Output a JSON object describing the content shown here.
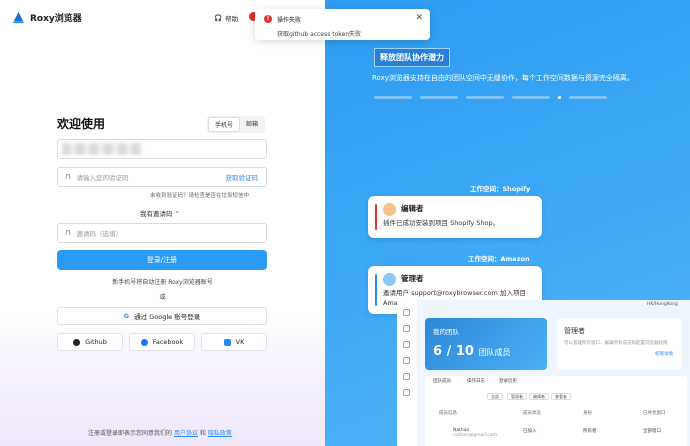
{
  "brand": {
    "name": "Roxy浏览器"
  },
  "header": {
    "help_label": "帮助"
  },
  "toast": {
    "title": "操作失败",
    "message": "获取github access token失败",
    "error_icon": "!"
  },
  "login": {
    "title": "欢迎使用",
    "tabs": [
      {
        "label": "手机号",
        "active": true
      },
      {
        "label": "邮箱",
        "active": false
      }
    ],
    "code_placeholder": "请输入您的验证码",
    "get_code_label": "获取验证码",
    "hint": "未收到验证码？请检查是否在垃圾短信中",
    "invite_toggle": "我有邀请码 ⌃",
    "invite_placeholder": "邀请码（选填）",
    "submit_label": "登录/注册",
    "auto_register_note": "新手机号将自动注册 Roxy浏览器账号",
    "or_label": "或",
    "google_label": "通过 Google 账号登录",
    "github_label": "Github",
    "facebook_label": "Facebook",
    "vk_label": "VK",
    "footer_prefix": "注册或登录即表示您同意我们的",
    "footer_terms": "用户协议",
    "footer_and": "和",
    "footer_privacy": "隐私政策"
  },
  "promo": {
    "headline": "释放团队协作潜力",
    "subline": "Roxy浏览器支持在自由的团队空间中无缝协作，每个工作空间数据与资源完全隔离。",
    "workspace1": "工作空间：Shopify",
    "card1": {
      "name": "编辑者",
      "text": "插件已成功安装到项目 Shopify Shop。",
      "accent": "#e0322e"
    },
    "workspace2": "工作空间：Amazon",
    "card2": {
      "name": "管理者",
      "text": "邀请用户 support@roxybrowser.com 加入项目 Amazon Shop。",
      "accent": "#2d8cf0"
    },
    "panel": {
      "topbar": "HK/HongKong",
      "team_label": "我的团队",
      "team_count": "6 / 10",
      "team_suffix": "团队成员",
      "admin_label": "管理者",
      "admin_desc": "可以管理所有窗口、编辑所有成员和配置浏览器权限",
      "admin_link": "权限详情",
      "tabs": [
        "团队成员",
        "操作日志",
        "登录历史"
      ],
      "pills": [
        "全部",
        "管理者",
        "编辑者",
        "查看者"
      ],
      "columns": [
        "成员信息",
        "成员状态",
        "身份",
        "已共享窗口"
      ],
      "row": {
        "name": "Nathan",
        "email": "nathan@gmail.com",
        "status": "已加入",
        "role": "所有者",
        "shared": "全部窗口"
      }
    }
  }
}
